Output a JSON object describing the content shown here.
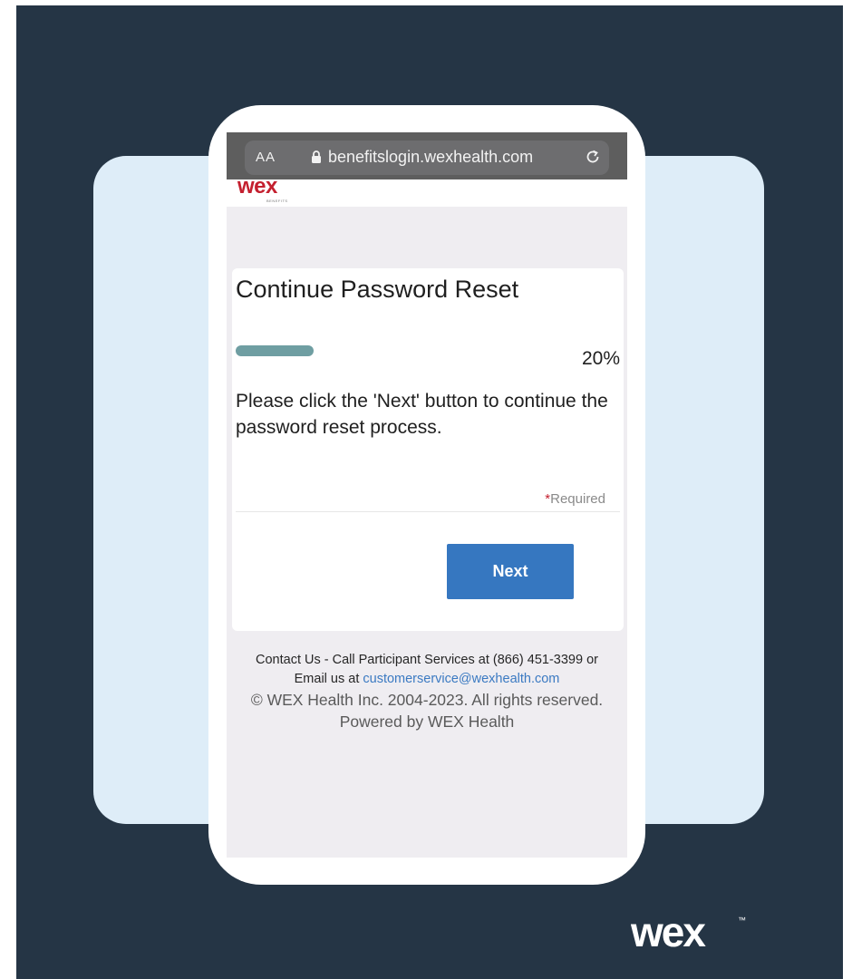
{
  "browser": {
    "text_size_label": "AA",
    "url": "benefitslogin.wexhealth.com",
    "lock_icon": "lock-icon",
    "reload_icon": "reload-icon"
  },
  "header": {
    "logo_text": "wex",
    "logo_subtext": "BENEFITS",
    "logo_color": "#c4202f"
  },
  "card": {
    "title": "Continue Password Reset",
    "progress_label": "20%",
    "progress_value": 0.2,
    "progress_color": "#6f9ea2",
    "message": "Please click the 'Next' button to continue the password reset process.",
    "required_star": "*",
    "required_label": "Required",
    "next_label": "Next",
    "next_color": "#3677c0"
  },
  "footer": {
    "contact": "Contact Us - Call Participant Services at (866) 451-3399 or",
    "email_prefix": "Email us at ",
    "email": "customerservice@wexhealth.com",
    "copyright": "© WEX Health Inc. 2004-2023. All rights reserved.",
    "powered_by": "Powered by WEX Health"
  },
  "brand": {
    "logo_text": "wex",
    "trademark": "™"
  },
  "colors": {
    "background_dark": "#253545",
    "background_panel": "#deedf8",
    "link": "#3b7ac2"
  }
}
